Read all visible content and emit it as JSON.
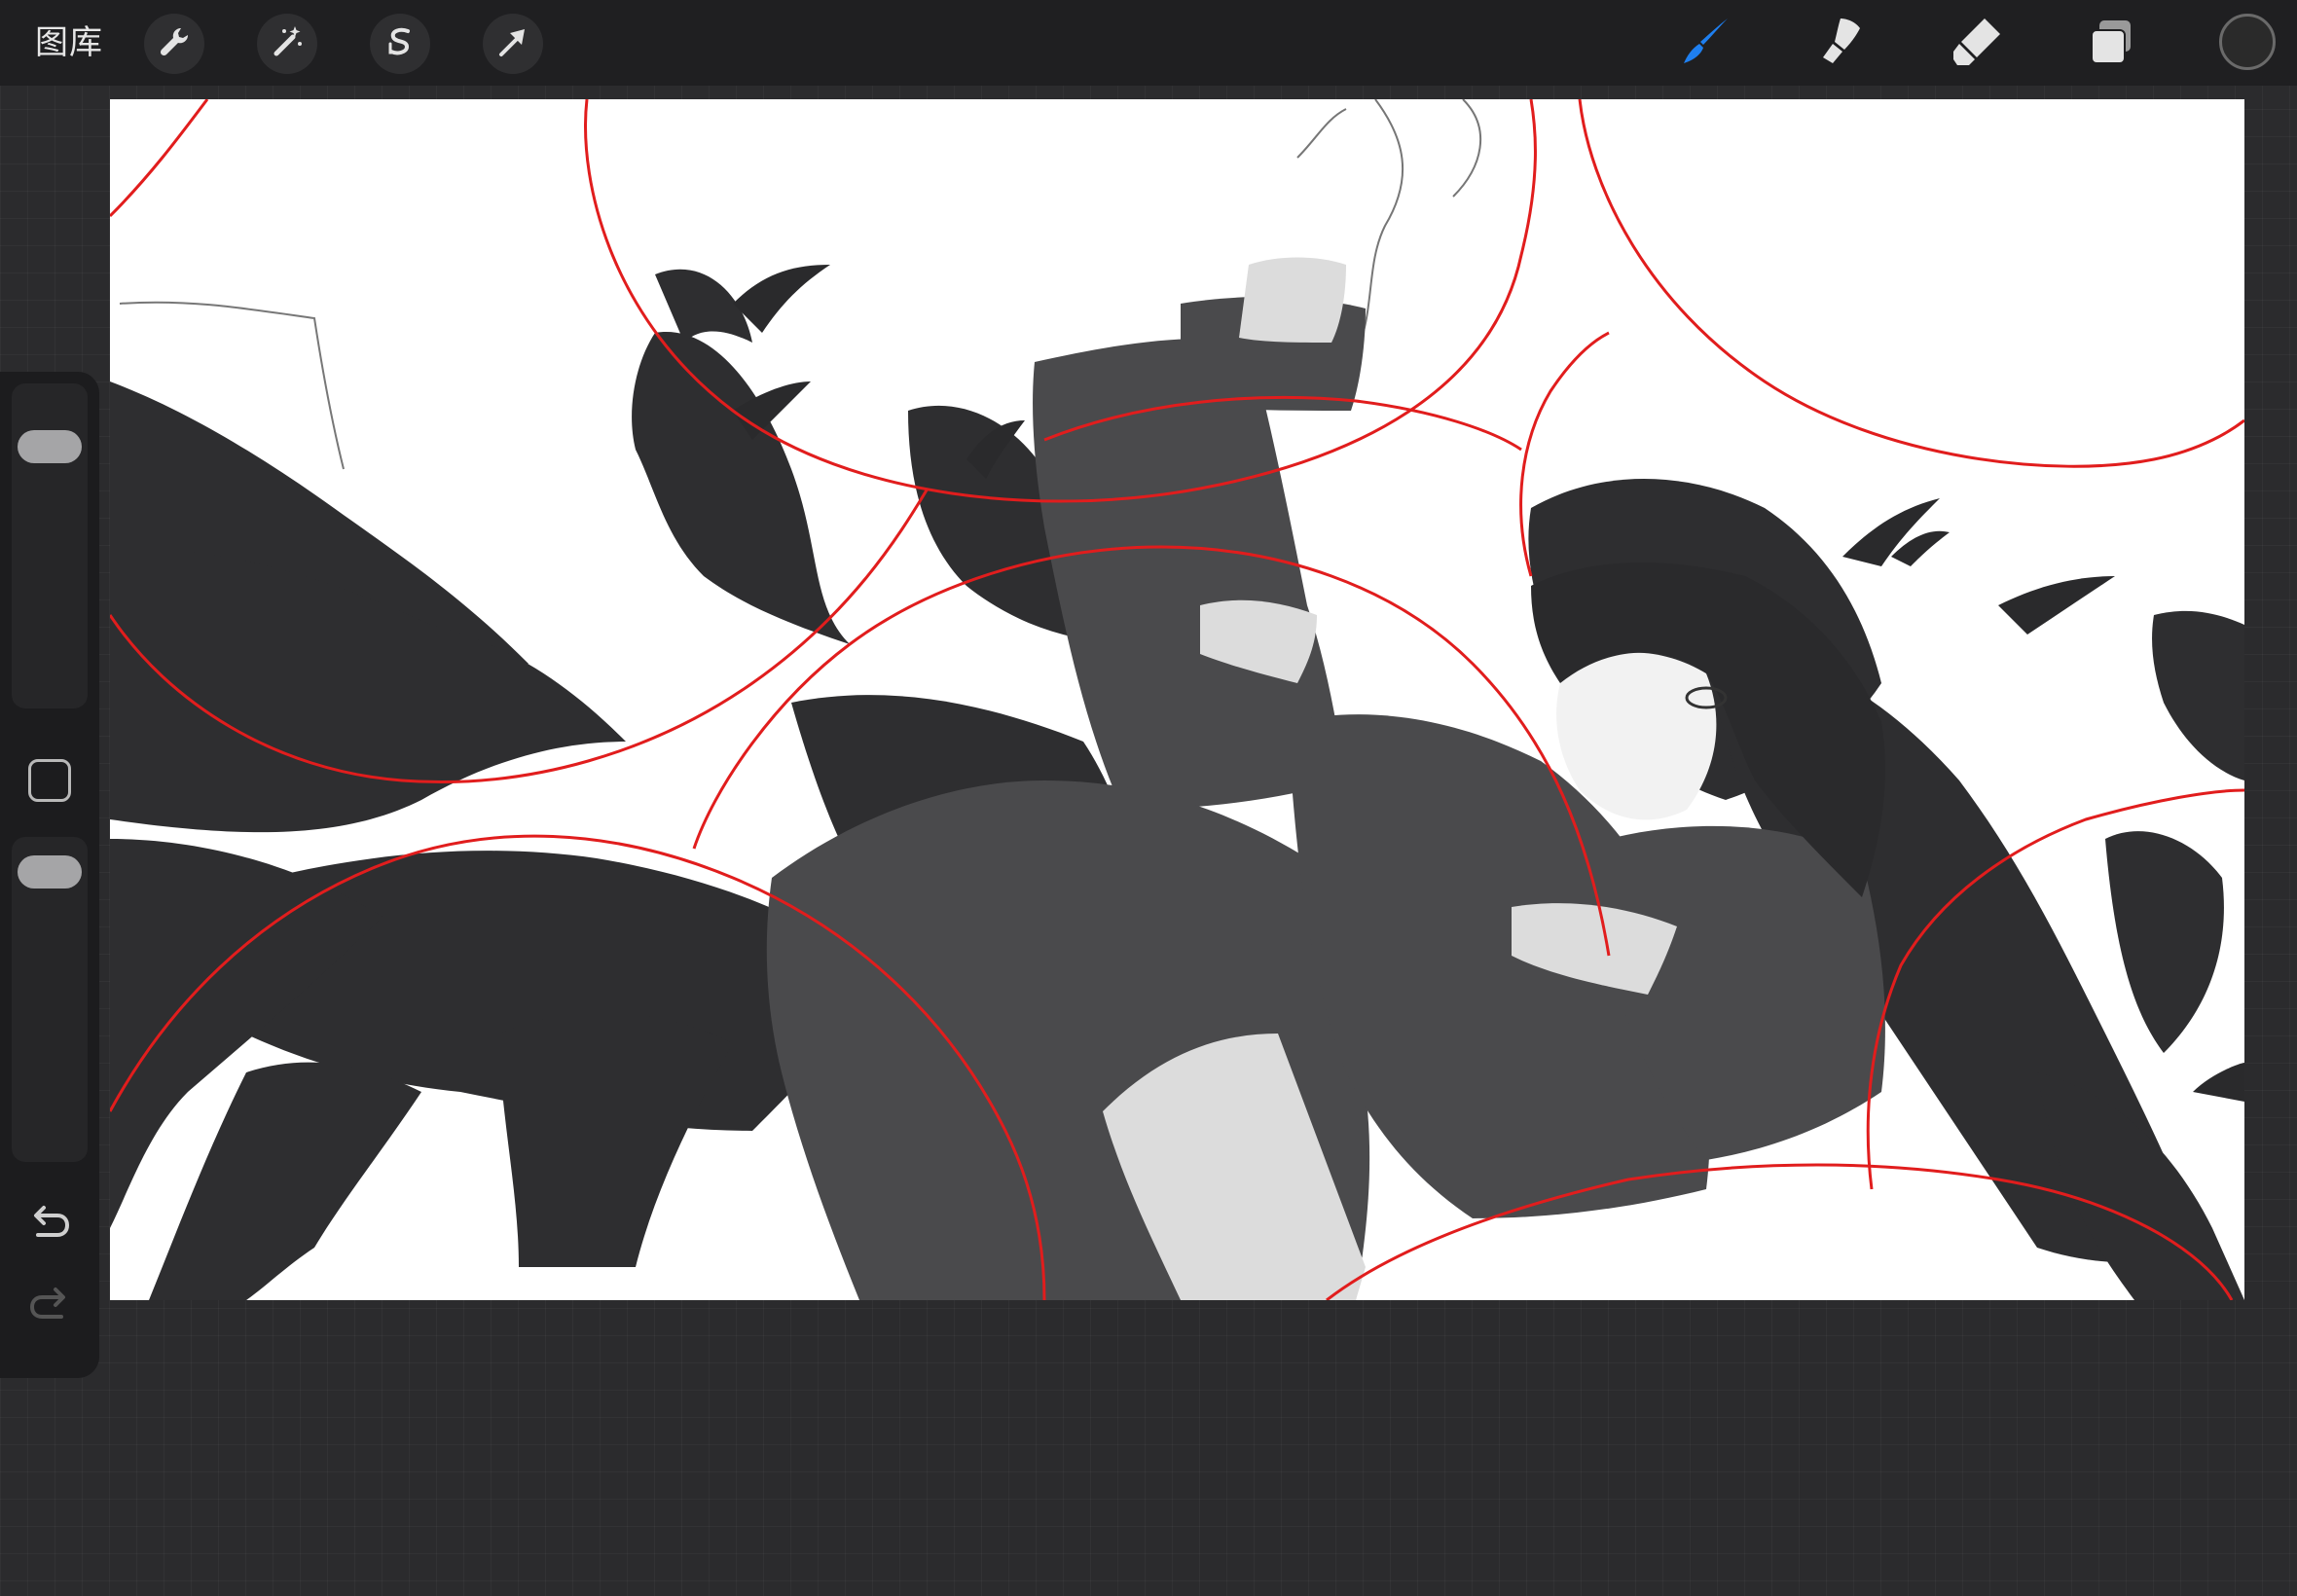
{
  "toolbar": {
    "gallery_label": "图库",
    "left_tools": [
      {
        "icon": "wrench-icon",
        "name": "actions"
      },
      {
        "icon": "magic-wand-icon",
        "name": "adjustments"
      },
      {
        "icon": "selection-s-icon",
        "name": "selection"
      },
      {
        "icon": "transform-arrow-icon",
        "name": "transform"
      }
    ],
    "right_tools": [
      {
        "icon": "brush-icon",
        "name": "paint",
        "active": true
      },
      {
        "icon": "smudge-icon",
        "name": "smudge"
      },
      {
        "icon": "eraser-icon",
        "name": "erase"
      },
      {
        "icon": "layers-icon",
        "name": "layers"
      }
    ],
    "active_color": "#2a2a2a",
    "accent_color": "#1e7ff0"
  },
  "sidebar": {
    "brush_size": 0.15,
    "brush_opacity": 0.1
  }
}
